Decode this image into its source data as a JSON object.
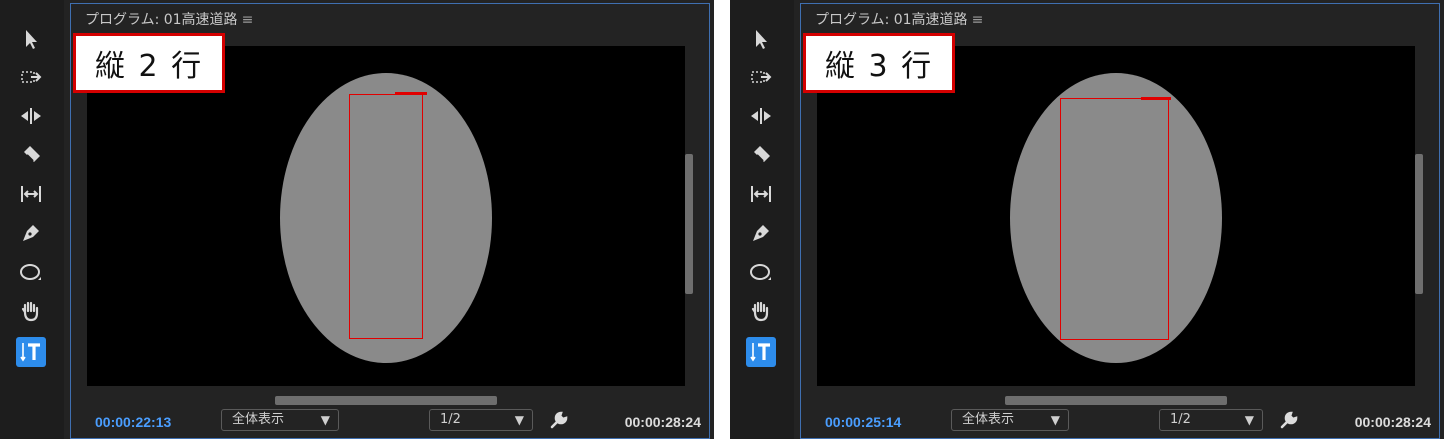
{
  "panels": [
    {
      "title": "プログラム: 01高速道路",
      "menu_icon": "≡",
      "label": "縦 2 行",
      "timecode_current": "00:00:22:13",
      "zoom_select": "全体表示",
      "resolution_select": "1/2",
      "timecode_duration": "00:00:28:24"
    },
    {
      "title": "プログラム: 01高速道路",
      "menu_icon": "≡",
      "label": "縦 3 行",
      "timecode_current": "00:00:25:14",
      "zoom_select": "全体表示",
      "resolution_select": "1/2",
      "timecode_duration": "00:00:28:24"
    }
  ],
  "tools": [
    "selection-tool-icon",
    "track-select-tool-icon",
    "ripple-edit-tool-icon",
    "razor-tool-icon",
    "slip-tool-icon",
    "pen-tool-icon",
    "ellipse-tool-icon",
    "hand-tool-icon",
    "vertical-type-tool-icon"
  ],
  "colors": {
    "accent": "#2d8ceb",
    "timecode_current": "#4a9eff",
    "highlight_border": "#d40000"
  }
}
